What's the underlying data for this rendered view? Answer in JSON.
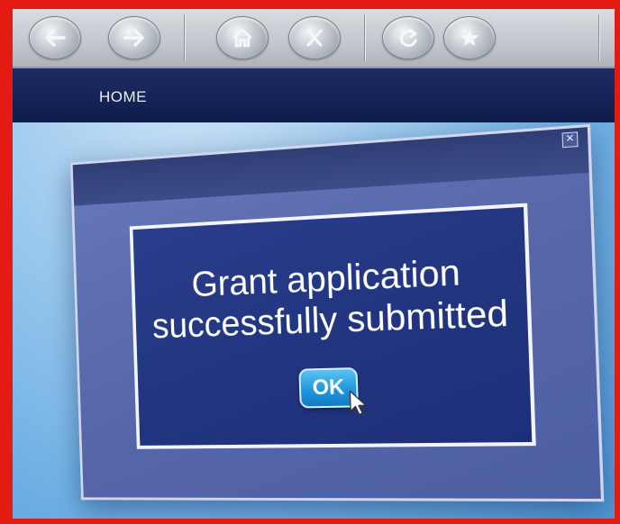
{
  "toolbar": {
    "buttons": [
      {
        "name": "back-button",
        "icon": "arrow-left-icon"
      },
      {
        "name": "forward-button",
        "icon": "arrow-right-icon"
      },
      {
        "name": "home-button",
        "icon": "home-icon"
      },
      {
        "name": "stop-button",
        "icon": "close-icon"
      },
      {
        "name": "refresh-button",
        "icon": "refresh-icon"
      },
      {
        "name": "favorites-button",
        "icon": "star-icon"
      }
    ]
  },
  "navbar": {
    "home_label": "HOME"
  },
  "dialog": {
    "close_glyph": "✕",
    "message_line1": "Grant application",
    "message_line2": "successfully submitted",
    "ok_label": "OK"
  },
  "colors": {
    "frame_border": "#e31b12",
    "navbar": "#142356",
    "dialog_inner": "#223580",
    "ok_button": "#1d93dc"
  }
}
